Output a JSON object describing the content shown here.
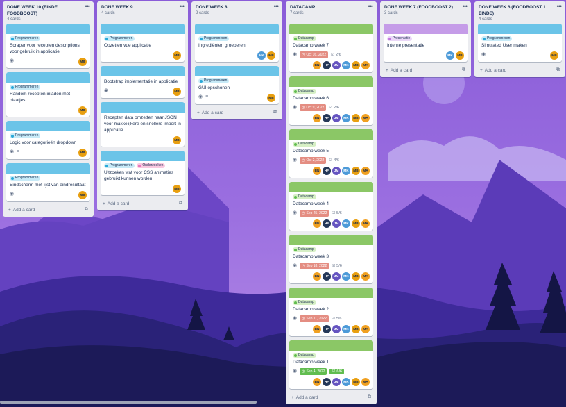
{
  "colors": {
    "cover_blue": "#6bc4e8",
    "cover_green": "#8bc766",
    "cover_purple": "#c59ce8",
    "label_programmeren": "#c7eaf7",
    "label_programmeren_dot": "#29a8d8",
    "label_onderzoeken": "#f9c8e0",
    "label_onderzoeken_dot": "#e774bb",
    "label_datacamp": "#d6efc5",
    "label_datacamp_dot": "#61bd4f",
    "label_presentatie": "#ead7f7",
    "label_presentatie_dot": "#c377e0",
    "date_overdue": "#e48d82",
    "date_done": "#61bd4f",
    "avatar_BN": "#f0a020",
    "avatar_HF": "#253858",
    "avatar_JM": "#6554c0",
    "avatar_MK": "#4c9ad8",
    "avatar_MB": "#e89f10",
    "avatar_MA": "#f0a020"
  },
  "icons": {
    "eye": "eye-icon",
    "description": "description-icon",
    "clock": "clock-icon",
    "checklist": "checklist-icon",
    "menu": "more-horizontal-icon",
    "plus": "plus-icon",
    "template": "template-icon"
  },
  "add_card_label": "Add a card",
  "lists": [
    {
      "title": "DONE WEEK 10 (EINDE FOODBOOST)",
      "count": "4 cards",
      "cards": [
        {
          "cover": "blue",
          "labels": [
            {
              "text": "Programmeren",
              "kind": "programmeren"
            }
          ],
          "title": "Scraper voor recepten descriptions voor gebruik in applicatie",
          "icons": [
            "eye"
          ],
          "members": [
            "MB"
          ]
        },
        {
          "cover": "blue",
          "labels": [
            {
              "text": "Programmeren",
              "kind": "programmeren"
            }
          ],
          "title": "Random recepten inladen met plaatjes",
          "icons": [],
          "members": [
            "MB"
          ]
        },
        {
          "cover": "blue",
          "labels": [
            {
              "text": "Programmeren",
              "kind": "programmeren"
            }
          ],
          "title": "Logic voor categorieën dropdown",
          "icons": [
            "eye",
            "description"
          ],
          "members": [
            "MB"
          ]
        },
        {
          "cover": "blue",
          "labels": [
            {
              "text": "Programmeren",
              "kind": "programmeren"
            }
          ],
          "title": "Eindscherm met lijst van eindresultaat",
          "icons": [
            "eye"
          ],
          "members": [
            "MB"
          ]
        }
      ]
    },
    {
      "title": "DONE WEEK 9",
      "count": "4 cards",
      "cards": [
        {
          "cover": "blue",
          "labels": [
            {
              "text": "Programmeren",
              "kind": "programmeren"
            }
          ],
          "title": "Opzetten vue applicatie",
          "icons": [],
          "members": [
            "MB"
          ]
        },
        {
          "cover": "blue",
          "labels": [],
          "title": "Bootstrap implementatie in applicatie",
          "icons": [
            "eye"
          ],
          "members": [
            "MB"
          ]
        },
        {
          "cover": "blue",
          "labels": [],
          "title": "Recepten data omzetten naar JSON voor makkelijkere en snellere import in applicatie",
          "icons": [],
          "members": [
            "MB"
          ]
        },
        {
          "cover": "blue",
          "labels": [
            {
              "text": "Programmeren",
              "kind": "programmeren"
            },
            {
              "text": "Onderzoeken",
              "kind": "onderzoeken"
            }
          ],
          "title": "Uitzoeken wat voor CSS animaties gebruikt kunnen worden",
          "icons": [],
          "members": [
            "MB"
          ]
        }
      ]
    },
    {
      "title": "DONE WEEK 8",
      "count": "2 cards",
      "cards": [
        {
          "cover": "blue",
          "labels": [
            {
              "text": "Programmeren",
              "kind": "programmeren"
            }
          ],
          "title": "Ingrediënten groeperen",
          "icons": [],
          "members": [
            "MK",
            "MB"
          ]
        },
        {
          "cover": "blue",
          "labels": [
            {
              "text": "Programmeren",
              "kind": "programmeren"
            }
          ],
          "title": "GUI opschonen",
          "icons": [
            "eye",
            "description"
          ],
          "members": [
            "MB"
          ]
        }
      ]
    },
    {
      "title": "DATACAMP",
      "count": "7 cards",
      "cards": [
        {
          "cover": "green",
          "labels": [
            {
              "text": "Datacamp",
              "kind": "datacamp"
            }
          ],
          "title": "Datacamp week 7",
          "icons": [
            "eye"
          ],
          "date": "Oct 16, 2022",
          "date_state": "overdue",
          "checklist": "2/6",
          "members": [
            "BN",
            "HF",
            "JM",
            "MK",
            "MB",
            "MA"
          ]
        },
        {
          "cover": "green",
          "labels": [
            {
              "text": "Datacamp",
              "kind": "datacamp"
            }
          ],
          "title": "Datacamp week 6",
          "icons": [
            "eye"
          ],
          "date": "Oct 9, 2022",
          "date_state": "overdue",
          "checklist": "2/6",
          "members": [
            "BN",
            "HF",
            "JM",
            "MK",
            "MB",
            "MA"
          ]
        },
        {
          "cover": "green",
          "labels": [
            {
              "text": "Datacamp",
              "kind": "datacamp"
            }
          ],
          "title": "Datacamp week 5",
          "icons": [
            "eye"
          ],
          "date": "Oct 2, 2022",
          "date_state": "overdue",
          "checklist": "4/6",
          "members": [
            "BN",
            "HF",
            "JM",
            "MK",
            "MB",
            "MA"
          ]
        },
        {
          "cover": "green",
          "labels": [
            {
              "text": "Datacamp",
              "kind": "datacamp"
            }
          ],
          "title": "Datacamp week 4",
          "icons": [
            "eye"
          ],
          "date": "Sep 25, 2022",
          "date_state": "overdue",
          "checklist": "5/6",
          "members": [
            "BN",
            "HF",
            "JM",
            "MK",
            "MB",
            "MA"
          ]
        },
        {
          "cover": "green",
          "labels": [
            {
              "text": "Datacamp",
              "kind": "datacamp"
            }
          ],
          "title": "Datacamp week 3",
          "icons": [
            "eye"
          ],
          "date": "Sep 18, 2022",
          "date_state": "overdue",
          "checklist": "5/6",
          "members": [
            "BN",
            "HF",
            "JM",
            "MK",
            "MB",
            "MA"
          ]
        },
        {
          "cover": "green",
          "labels": [
            {
              "text": "Datacamp",
              "kind": "datacamp"
            }
          ],
          "title": "Datacamp week 2",
          "icons": [
            "eye"
          ],
          "date": "Sep 11, 2022",
          "date_state": "overdue",
          "checklist": "5/6",
          "members": [
            "BN",
            "HF",
            "JM",
            "MK",
            "MB",
            "MA"
          ]
        },
        {
          "cover": "green",
          "labels": [
            {
              "text": "Datacamp",
              "kind": "datacamp"
            }
          ],
          "title": "Datacamp week 1",
          "icons": [
            "eye"
          ],
          "date": "Sep 4, 2022",
          "date_state": "done",
          "checklist": "6/6",
          "checklist_done": true,
          "members": [
            "BN",
            "HF",
            "JM",
            "MK",
            "MB",
            "MA"
          ]
        }
      ]
    },
    {
      "title": "DONE WEEK 7 (FOODBOOST 2)",
      "count": "3 cards",
      "cards": [
        {
          "cover": "purple",
          "labels": [
            {
              "text": "Presentatie",
              "kind": "presentatie"
            }
          ],
          "title": "Interne presentatie",
          "icons": [],
          "members": [
            "MK",
            "MB"
          ]
        }
      ]
    },
    {
      "title": "DONE WEEK 6 (FOODBOOST 1 EINDE)",
      "count": "4 cards",
      "cards": [
        {
          "cover": "blue",
          "labels": [
            {
              "text": "Programmeren",
              "kind": "programmeren"
            }
          ],
          "title": "Simulated User maken",
          "icons": [
            "eye"
          ],
          "members": [
            "MB"
          ]
        }
      ]
    }
  ]
}
